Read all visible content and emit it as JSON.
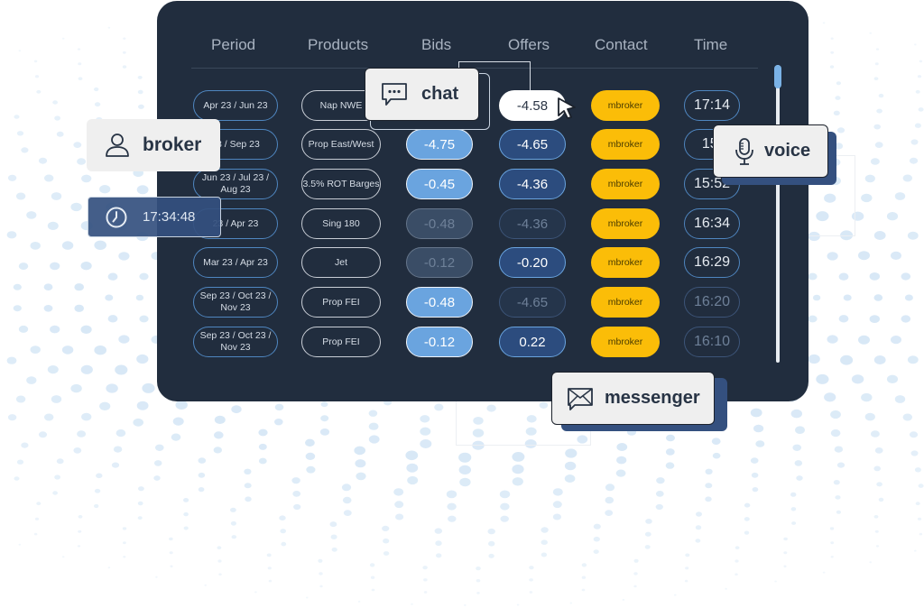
{
  "table": {
    "headers": [
      "Period",
      "Products",
      "Bids",
      "Offers",
      "Contact",
      "Time"
    ],
    "rows": [
      {
        "period": "Apr 23 / Jun 23",
        "product": "Nap NWE",
        "bid": "",
        "offer": "-4.58",
        "contact": "mbroker",
        "time": "17:14",
        "bid_state": "hidden",
        "offer_state": "selected",
        "time_state": "normal"
      },
      {
        "period": "Aug 23 / Sep 23",
        "period_visible": "23 / Sep 23",
        "product": "Prop East/West",
        "bid": "-4.75",
        "offer": "-4.65",
        "contact": "mbroker",
        "time": "15:",
        "bid_state": "active",
        "offer_state": "active",
        "time_state": "normal"
      },
      {
        "period": "Jun 23 / Jul 23 / Aug 23",
        "product": "3.5% ROT Barges",
        "bid": "-0.45",
        "offer": "-4.36",
        "contact": "mbroker",
        "time": "15:52",
        "bid_state": "active",
        "offer_state": "active",
        "time_state": "normal"
      },
      {
        "period": "23 / Apr 23",
        "product": "Sing 180",
        "bid": "-0.48",
        "offer": "-4.36",
        "contact": "mbroker",
        "time": "16:34",
        "bid_state": "disabled",
        "offer_state": "dim",
        "time_state": "normal"
      },
      {
        "period": "Mar 23 / Apr 23",
        "product": "Jet",
        "bid": "-0.12",
        "offer": "-0.20",
        "contact": "mbroker",
        "time": "16:29",
        "bid_state": "disabled",
        "offer_state": "active",
        "time_state": "normal"
      },
      {
        "period": "Sep 23 / Oct 23 / Nov 23",
        "product": "Prop FEI",
        "bid": "-0.48",
        "offer": "-4.65",
        "contact": "mbroker",
        "time": "16:20",
        "bid_state": "active",
        "offer_state": "dim",
        "time_state": "dim"
      },
      {
        "period": "Sep 23 / Oct 23 / Nov 23",
        "product": "Prop FEI",
        "bid": "-0.12",
        "offer": "0.22",
        "contact": "mbroker",
        "time": "16:10",
        "bid_state": "active",
        "offer_state": "active",
        "time_state": "dim"
      }
    ]
  },
  "cards": {
    "chat": {
      "label": "chat",
      "icon": "chat-bubble-icon"
    },
    "broker": {
      "label": "broker",
      "icon": "user-icon"
    },
    "clock": {
      "label": "17:34:48",
      "icon": "clock-icon"
    },
    "voice": {
      "label": "voice",
      "icon": "microphone-icon"
    },
    "messenger": {
      "label": "messenger",
      "icon": "envelope-icon"
    }
  },
  "scrollbar": {
    "position": 0.0
  },
  "colors": {
    "panel": "#212d3e",
    "accent_blue": "#6aa4df",
    "dark_blue": "#2c4c7e",
    "contact_yellow": "#fbbd08",
    "card_bg": "#efefef"
  }
}
